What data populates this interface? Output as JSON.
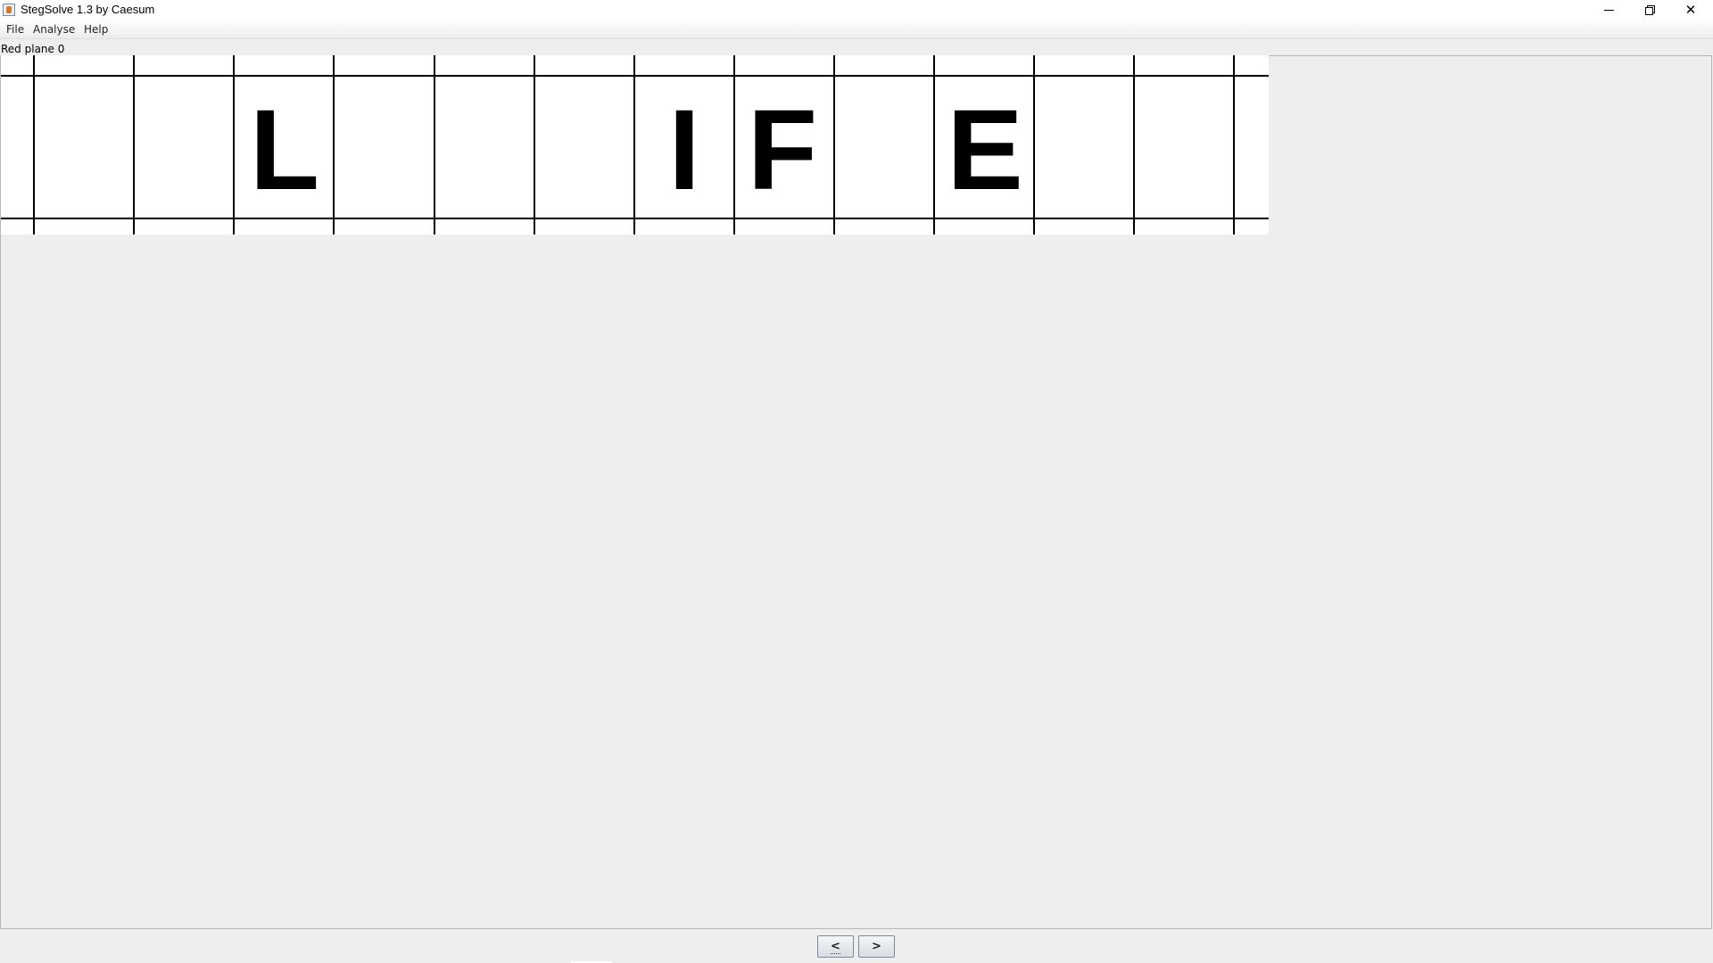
{
  "window": {
    "title": "StegSolve 1.3 by Caesum",
    "controls": {
      "minimize": "minimize-icon",
      "maximize": "restore-icon",
      "close": "close-icon"
    }
  },
  "menu": {
    "items": [
      "File",
      "Analyse",
      "Help"
    ]
  },
  "viewer": {
    "plane_label": "Red plane 0",
    "image_letters": [
      "L",
      "I",
      "F",
      "E"
    ]
  },
  "navigation": {
    "prev_label": "<",
    "next_label": ">"
  },
  "colors": {
    "background": "#eeeeee",
    "image_background": "#ffffff",
    "grid_lines": "#000000"
  }
}
